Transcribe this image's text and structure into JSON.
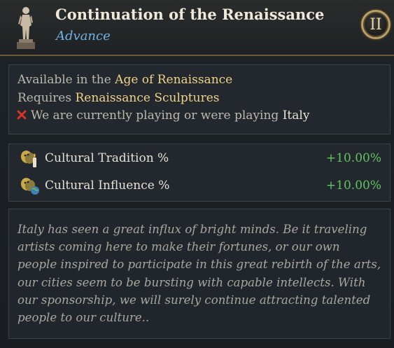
{
  "header": {
    "title": "Continuation of the Renaissance",
    "subtitle": "Advance",
    "tier": "II"
  },
  "requirements": {
    "age_prefix": "Available in the",
    "age_value": "Age of Renaissance",
    "requires_prefix": "Requires",
    "requires_value": "Renaissance Sculptures",
    "condition_prefix": "We are currently playing or were playing",
    "condition_value": "Italy"
  },
  "effects": [
    {
      "label": "Cultural Tradition %",
      "value": "+10.00%",
      "icon": "culture-tradition-icon"
    },
    {
      "label": "Cultural Influence %",
      "value": "+10.00%",
      "icon": "culture-influence-icon"
    }
  ],
  "description": "Italy has seen a great influx of bright minds. Be it traveling artists coming here to make their fortunes, or our own people inspired to participate in this great rebirth of the arts, our cities seem to be bursting with capable intellects. With our sponsorship, we will surely continue attracting talented people to our culture..",
  "colors": {
    "accent_gold": "#f0d38a",
    "subtitle_blue": "#6fb2e3",
    "positive_green": "#63c463",
    "fail_red": "#d9342b"
  }
}
